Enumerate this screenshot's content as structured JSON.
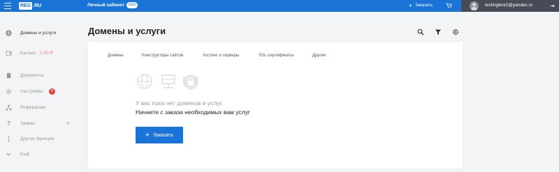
{
  "header": {
    "logo_main": "REG",
    "logo_suffix": ".RU",
    "cabinet_label": "Личный кабинет",
    "beta_label": "beta",
    "order_label": "Заказать",
    "user_email": "testingtest2@yandex.ru",
    "bg_color": "#1a73d6",
    "icons": [
      "menu-icon",
      "plus-icon",
      "cart-icon",
      "avatar",
      "logout-icon"
    ]
  },
  "sidebar": {
    "items": [
      {
        "label": "Домены и услуги",
        "icon": "globe-icon",
        "active": true
      },
      {
        "label": "Баланс",
        "value": "0,00 ₽",
        "icon": "wallet-icon"
      },
      {
        "label": "Документы",
        "icon": "document-icon"
      },
      {
        "label": "Настройки",
        "badge": "4",
        "icon": "gear-icon"
      },
      {
        "label": "Рефералам",
        "icon": "referral-icon"
      },
      {
        "label": "Заявки",
        "icon": "question-icon"
      },
      {
        "label": "Другие функции",
        "icon": "more-icon"
      },
      {
        "label": "Ещё",
        "icon": "chevron-down-icon"
      }
    ]
  },
  "main": {
    "title": "Домены и услуги",
    "tools": [
      "search-icon",
      "filter-icon",
      "gear-icon"
    ],
    "tabs": [
      "Домены",
      "Конструкторы сайтов",
      "Хостинг и серверы",
      "SSL-сертификаты",
      "Другие"
    ],
    "empty_title": "У вас пока нет доменов и услуг.",
    "empty_subtitle": "Начните с заказа необходимых вам услуг",
    "order_button": "Заказать",
    "accent_color": "#1a73d6",
    "badge_color": "#e84141"
  }
}
